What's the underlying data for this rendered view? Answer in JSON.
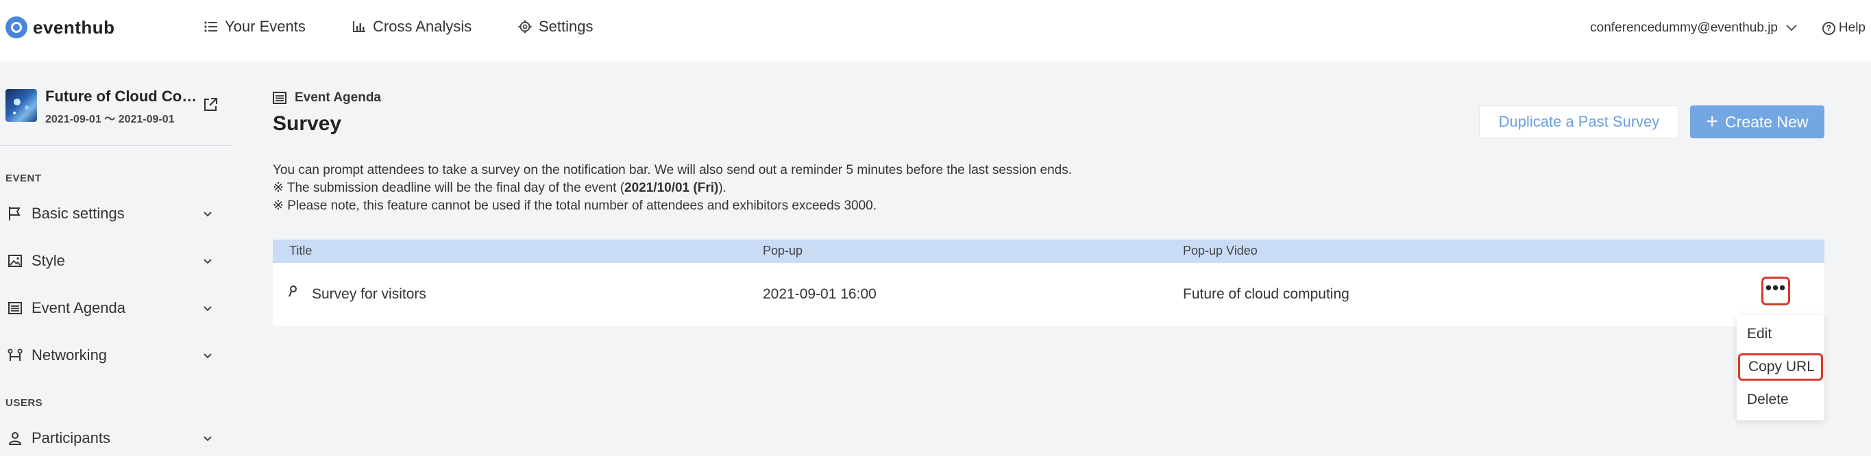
{
  "header": {
    "logo_text": "eventhub",
    "nav": [
      {
        "label": "Your Events",
        "icon": "list-icon"
      },
      {
        "label": "Cross Analysis",
        "icon": "bar-chart-icon"
      },
      {
        "label": "Settings",
        "icon": "gear-icon"
      }
    ],
    "user_email": "conferencedummy@eventhub.jp",
    "help_label": "Help"
  },
  "sidebar": {
    "event_name": "Future of Cloud Computing",
    "event_dates": "2021-09-01 ～ 2021-09-01",
    "sections": [
      {
        "title": "EVENT",
        "items": [
          {
            "label": "Basic settings",
            "icon": "flag-icon"
          },
          {
            "label": "Style",
            "icon": "image-icon"
          },
          {
            "label": "Event Agenda",
            "icon": "agenda-icon"
          },
          {
            "label": "Networking",
            "icon": "networking-icon"
          }
        ]
      },
      {
        "title": "USERS",
        "items": [
          {
            "label": "Participants",
            "icon": "user-icon"
          }
        ]
      }
    ]
  },
  "main": {
    "breadcrumb": "Event Agenda",
    "title": "Survey",
    "duplicate_button": "Duplicate a Past Survey",
    "create_button": "Create New",
    "description": {
      "line1": "You can prompt attendees to take a survey on the notification bar. We will also send out a reminder 5 minutes before the last session ends.",
      "line2_prefix": "※ The submission deadline will be the final day of the event (",
      "line2_bold": "2021/10/01 (Fri)",
      "line2_suffix": ").",
      "line3": "※ Please note, this feature cannot be used if the total number of attendees and exhibitors exceeds 3000."
    },
    "table": {
      "columns": [
        "Title",
        "Pop-up",
        "Pop-up Video"
      ],
      "rows": [
        {
          "title": "Survey for visitors",
          "popup": "2021-09-01 16:00",
          "popup_video": "Future of cloud computing"
        }
      ]
    },
    "more_button": "•••",
    "row_menu": [
      "Edit",
      "Copy URL",
      "Delete"
    ]
  },
  "colors": {
    "accent": "#73a6e2",
    "table_header": "#c9dbf5",
    "highlight_border": "#d9372b"
  }
}
